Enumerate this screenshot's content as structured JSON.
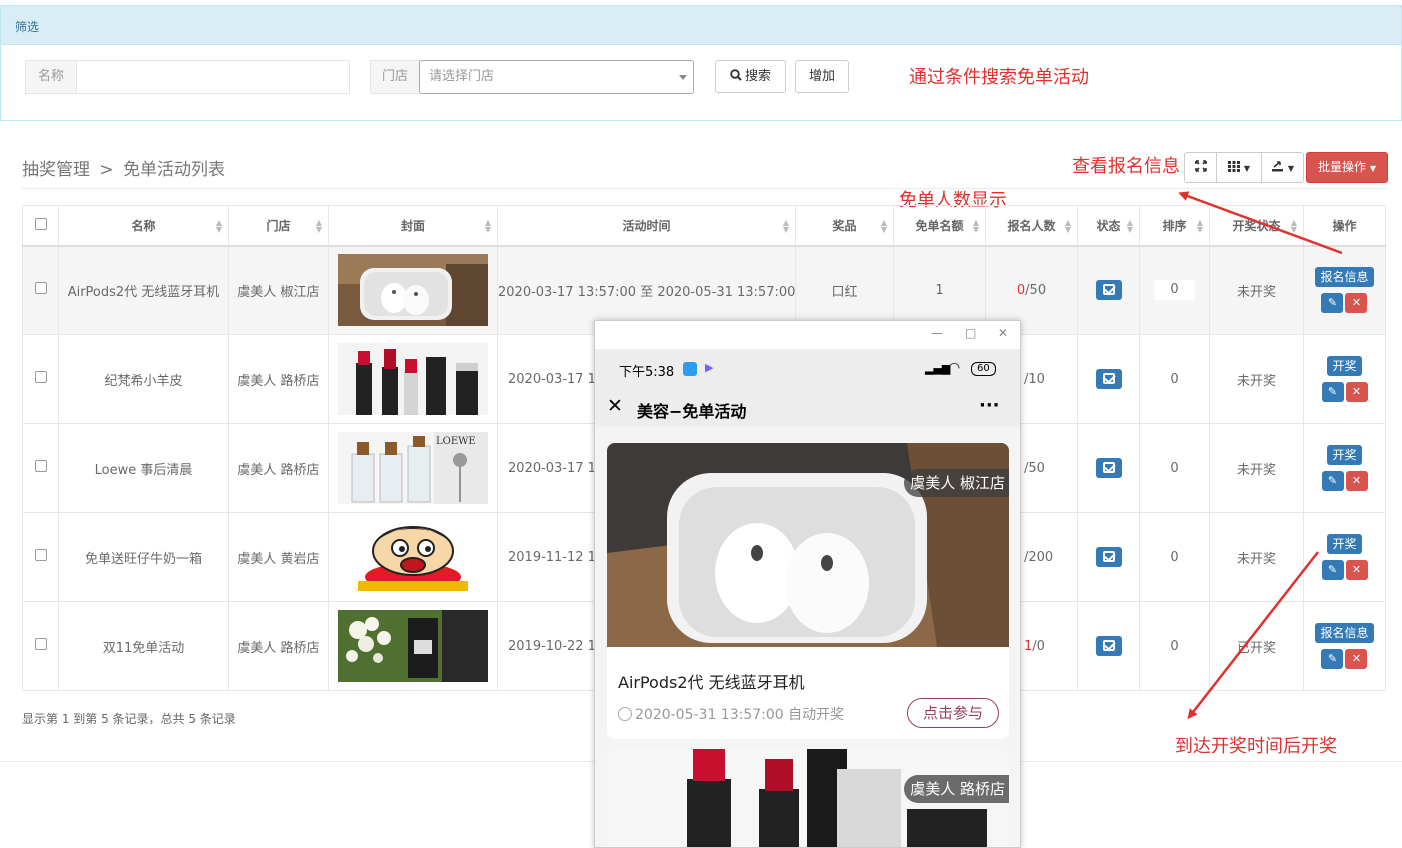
{
  "filter": {
    "title": "筛选",
    "name_label": "名称",
    "name_value": "",
    "store_label": "门店",
    "store_placeholder": "请选择门店",
    "search_label": "搜索",
    "add_label": "增加"
  },
  "annotations": {
    "search_note": "通过条件搜索免单活动",
    "signup_note": "查看报名信息",
    "count_note": "免单人数显示",
    "draw_note": "到达开奖时间后开奖"
  },
  "breadcrumb": {
    "parent": "抽奖管理",
    "sep": ">",
    "current": "免单活动列表"
  },
  "toolbar": {
    "batch_label": "批量操作"
  },
  "table": {
    "headers": [
      "名称",
      "门店",
      "封面",
      "活动时间",
      "奖品",
      "免单名额",
      "报名人数",
      "状态",
      "排序",
      "开奖状态",
      "操作"
    ],
    "rows": [
      {
        "name": "AirPods2代 无线蓝牙耳机",
        "store": "虞美人 椒江店",
        "time": "2020-03-17 13:57:00 至 2020-05-31 13:57:00",
        "prize": "口红",
        "quota": "1",
        "signup_count": "0",
        "signup_total": "/50",
        "sort": "0",
        "draw_status": "未开奖",
        "action": "报名信息"
      },
      {
        "name": "纪梵希小羊皮",
        "store": "虞美人 路桥店",
        "time": "2020-03-17 13",
        "prize": "",
        "quota": "",
        "signup_count": "",
        "signup_total": "/10",
        "sort": "0",
        "draw_status": "未开奖",
        "action": "开奖"
      },
      {
        "name": "Loewe 事后清晨",
        "store": "虞美人 路桥店",
        "time": "2020-03-17 13",
        "prize": "",
        "quota": "",
        "signup_count": "",
        "signup_total": "/50",
        "sort": "0",
        "draw_status": "未开奖",
        "action": "开奖"
      },
      {
        "name": "免单送旺仔牛奶一箱",
        "store": "虞美人 黄岩店",
        "time": "2019-11-12 14",
        "prize": "",
        "quota": "",
        "signup_count": "",
        "signup_total": "/200",
        "sort": "0",
        "draw_status": "未开奖",
        "action": "开奖"
      },
      {
        "name": "双11免单活动",
        "store": "虞美人 路桥店",
        "time": "2019-10-22 14",
        "prize": "",
        "quota": "",
        "signup_count": "1",
        "signup_total": "/0",
        "sort": "0",
        "draw_status": "已开奖",
        "action": "报名信息"
      }
    ]
  },
  "footer": {
    "info": "显示第 1 到第 5 条记录，总共 5 条记录"
  },
  "phone": {
    "time": "下午5:38",
    "battery": "60",
    "title": "美容−免单活动",
    "more": "···",
    "cards": [
      {
        "store": "虞美人 椒江店",
        "name": "AirPods2代 无线蓝牙耳机",
        "draw_time": "2020-05-31 13:57:00 自动开奖",
        "join": "点击参与"
      },
      {
        "store": "虞美人 路桥店"
      }
    ]
  },
  "colors": {
    "primary": "#337ab7",
    "danger": "#d9534f",
    "annotation": "#e0312e",
    "filter_bg": "#d9edf7"
  }
}
